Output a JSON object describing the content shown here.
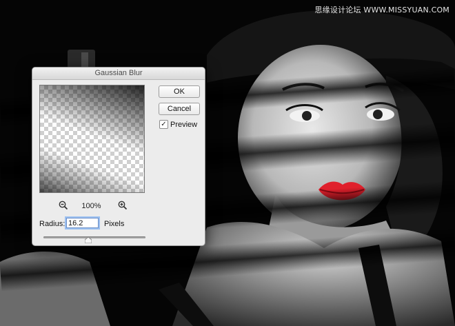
{
  "watermark": "思缘设计论坛 WWW.MISSYUAN.COM",
  "dialog": {
    "title": "Gaussian Blur",
    "ok_label": "OK",
    "cancel_label": "Cancel",
    "preview_label": "Preview",
    "preview_checked": true,
    "zoom_level": "100%",
    "radius_label": "Radius:",
    "radius_value": "16.2",
    "radius_unit": "Pixels",
    "slider_fraction": 0.44,
    "icons": [
      "zoom-out-icon",
      "zoom-in-icon",
      "checkmark-icon",
      "slider-thumb-icon"
    ]
  },
  "colors": {
    "lips": "#e0202c",
    "dialog_bg": "#ececec",
    "focus_ring": "#9cc0f0"
  }
}
